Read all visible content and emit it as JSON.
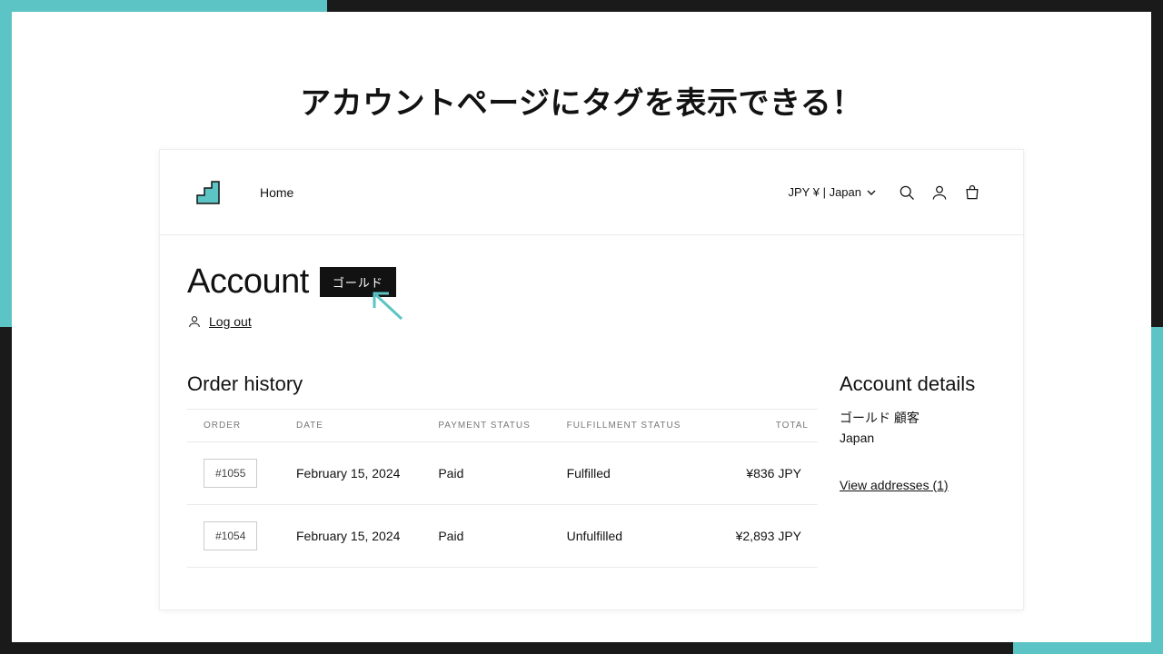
{
  "headline": "アカウントページにタグを表示できる！",
  "nav": {
    "home": "Home"
  },
  "currency": {
    "label": "JPY ¥ | Japan"
  },
  "account": {
    "title": "Account",
    "tag": "ゴールド",
    "logout": "Log out"
  },
  "orders": {
    "section_title": "Order history",
    "columns": {
      "order": "ORDER",
      "date": "DATE",
      "payment": "PAYMENT STATUS",
      "fulfillment": "FULFILLMENT STATUS",
      "total": "TOTAL"
    },
    "rows": [
      {
        "id": "#1055",
        "date": "February 15, 2024",
        "payment": "Paid",
        "fulfillment": "Fulfilled",
        "total": "¥836 JPY"
      },
      {
        "id": "#1054",
        "date": "February 15, 2024",
        "payment": "Paid",
        "fulfillment": "Unfulfilled",
        "total": "¥2,893 JPY"
      }
    ]
  },
  "details": {
    "section_title": "Account details",
    "name": "ゴールド 顧客",
    "country": "Japan",
    "view_addresses": "View addresses (1)"
  },
  "colors": {
    "accent": "#5cc4c4"
  }
}
